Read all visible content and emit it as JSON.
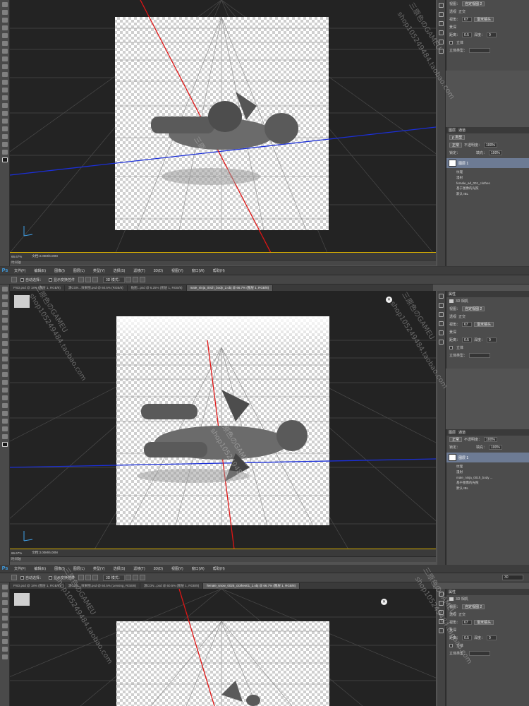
{
  "app": {
    "logo": "Ps",
    "accent": "#3fa0e8",
    "highlight": "#d8b000"
  },
  "menu": [
    "文件(F)",
    "编辑(E)",
    "图像(I)",
    "图层(L)",
    "类型(Y)",
    "选择(S)",
    "滤镜(T)",
    "3D(D)",
    "视图(V)",
    "窗口(W)",
    "帮助(H)"
  ],
  "options": {
    "auto_select": "自动选择：",
    "show_transform": "显示变换控件",
    "mode_label": "3D 模式：",
    "number": "30"
  },
  "tabs": [
    [
      "PSD.psd @ 18% (图层 1, RGB/8)",
      "源CON...psd @ 60.5% (RGB/8)",
      "贴图...psd @ 6.25% (图层 1, RGB/8)",
      "male_ninja_001h_body_2.obj @ 66.7% (图层 1, RGB/8)"
    ],
    [
      "PSD.psd @ 18% (图层 1, RGB/8)",
      "源CON...效果图.psd @ 60.5% (RGB/8)",
      "贴图...psd @ 6.25% (图层 1, RGB/8)",
      "male_ninja_001h_body_2.obj @ 66.7% (图层 1, RGB/8)"
    ],
    [
      "PSD.psd @ 18% (图层 1, RGB/8)",
      "源CON...效果图.psd @ 60.5% (Lensing, RGB/8)",
      "源CON...psd @ 60.5% (图层 1, RGB/8)",
      "female_snow_0025_clothes01_1.obj @ 66.7% (图层 1, RGB/8)"
    ]
  ],
  "status": {
    "zoom": "66.67%",
    "doc": "文档:3.00M/6.00M",
    "timeline": "时间轴"
  },
  "properties": {
    "title": "属性",
    "camera": "3D 相机",
    "view_label": "视图：",
    "view_value": "自定视图 2",
    "perspective": "透视",
    "ortho": "正交",
    "fov_label": "视角：",
    "fov_value": "67",
    "fov_unit": "毫米镜头",
    "depth_label": "景深",
    "distance_label": "距离：",
    "distance_value": "0.5",
    "depth_value_label": "深度：",
    "depth_value": "0",
    "stereo_label": "立体",
    "stereo_type": "立体类型："
  },
  "layers": {
    "tab1": "图层",
    "tab2": "通道",
    "kind": "ρ 类型",
    "blend": "正常",
    "opacity_label": "不透明度：",
    "opacity": "100%",
    "lock_label": "锁定：",
    "fill_label": "填充：",
    "fill": "100%",
    "layer_name": "图层 1",
    "textures": "纹理",
    "diffuse": "漫射",
    "file_a": "female_ad_001_clothes",
    "file_b": "male_ninja_001h_body ...",
    "ibl": "基于图像的光照",
    "ibl_default": "默认 IBL"
  },
  "watermark": {
    "shop": "三原色のGAMEU",
    "url": "shop105249484.taobao.com"
  }
}
